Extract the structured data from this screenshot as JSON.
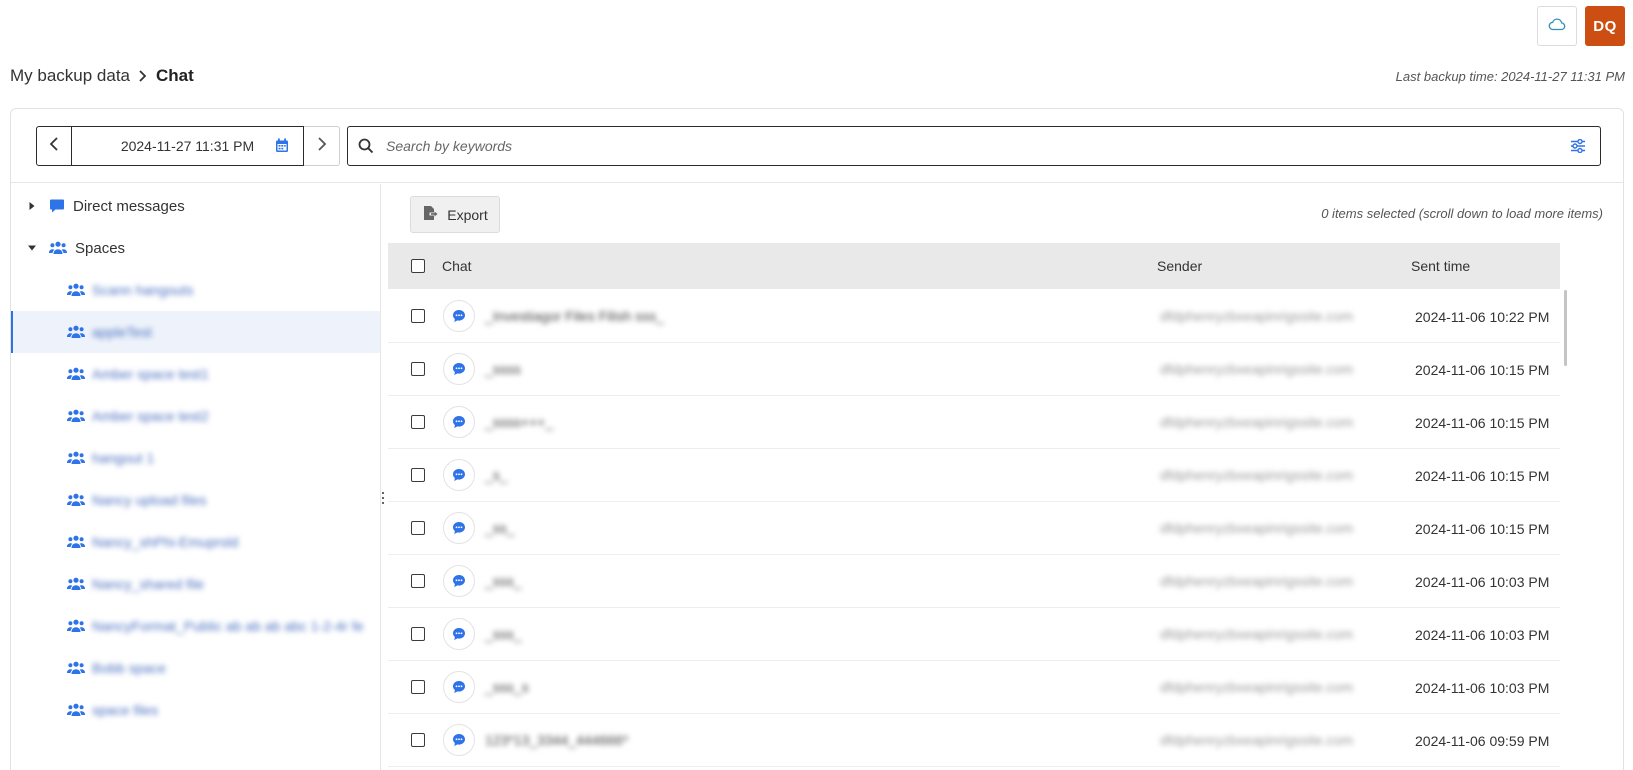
{
  "header": {
    "avatar_initials": "DQ",
    "cloud_icon": "cloud-icon"
  },
  "breadcrumb": {
    "parent": "My backup data",
    "current": "Chat"
  },
  "last_backup": "Last backup time: 2024-11-27 11:31 PM",
  "date_nav": {
    "value": "2024-11-27 11:31 PM"
  },
  "search": {
    "placeholder": "Search by keywords"
  },
  "sidebar": {
    "direct_messages": "Direct messages",
    "spaces": "Spaces",
    "space_items": [
      "Scann hangouts",
      "appleTest",
      "Amber space test1",
      "Amber space test2",
      "hangout 1",
      "Nancy upload files",
      "Nancy_shPhi-Emuprsld",
      "Nancy_shared file",
      "NancyFormat_Public ab ab ab abc 1-2-4r fe",
      "Bobb space",
      "space files"
    ]
  },
  "toolbar": {
    "export_label": "Export",
    "selected_info": "0 items selected (scroll down to load more items)"
  },
  "table": {
    "headers": {
      "chat": "Chat",
      "sender": "Sender",
      "sent_time": "Sent time"
    },
    "rows": [
      {
        "chat": "_Investiagor Files Filish sss_",
        "sender": "dfdphenryzbxeapinrigssite.com",
        "time": "2024-11-06 10:22 PM"
      },
      {
        "chat": "_ssss",
        "sender": "dfdphenryzbxeapinrigssite.com",
        "time": "2024-11-06 10:15 PM"
      },
      {
        "chat": "_ssss+++_",
        "sender": "dfdphenryzbxeapinrigssite.com",
        "time": "2024-11-06 10:15 PM"
      },
      {
        "chat": "_s_",
        "sender": "dfdphenryzbxeapinrigssite.com",
        "time": "2024-11-06 10:15 PM"
      },
      {
        "chat": "_ss_",
        "sender": "dfdphenryzbxeapinrigssite.com",
        "time": "2024-11-06 10:15 PM"
      },
      {
        "chat": "_sss_",
        "sender": "dfdphenryzbxeapinrigssite.com",
        "time": "2024-11-06 10:03 PM"
      },
      {
        "chat": "_sss_",
        "sender": "dfdphenryzbxeapinrigssite.com",
        "time": "2024-11-06 10:03 PM"
      },
      {
        "chat": "_sss_s",
        "sender": "dfdphenryzbxeapinrigssite.com",
        "time": "2024-11-06 10:03 PM"
      },
      {
        "chat": "123*13_3344_444666*",
        "sender": "dfdphenryzbxeapinrigssite.com",
        "time": "2024-11-06 09:59 PM"
      }
    ]
  },
  "colors": {
    "accent": "#2e73e8",
    "avatar_bg": "#cc4e12",
    "header_bg": "#e9e9e9"
  }
}
